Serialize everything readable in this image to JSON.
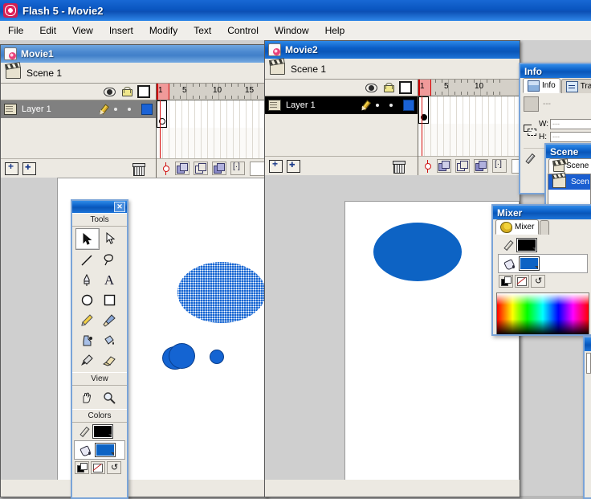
{
  "app": {
    "title": "Flash 5 - Movie2",
    "logo_icon": "flash-logo-icon"
  },
  "menubar": {
    "items": [
      {
        "label": "File"
      },
      {
        "label": "Edit"
      },
      {
        "label": "View"
      },
      {
        "label": "Insert"
      },
      {
        "label": "Modify"
      },
      {
        "label": "Text"
      },
      {
        "label": "Control"
      },
      {
        "label": "Window"
      },
      {
        "label": "Help"
      }
    ]
  },
  "movie1": {
    "title": "Movie1",
    "active": false,
    "scene_label": "Scene 1",
    "layer_headers": {
      "eye_icon": "eye-icon",
      "lock_icon": "lock-icon",
      "outline_icon": "outline-square-icon"
    },
    "layer": {
      "name": "Layer 1",
      "page_icon": "layer-page-icon",
      "pencil_icon": "pencil-icon",
      "swatch_color": "#1a62d6"
    },
    "ruler_labels": [
      "1",
      "5",
      "10",
      "15"
    ],
    "current_frame": "1",
    "bottom_icons": {
      "add_layer_icon": "add-layer-icon",
      "add_guide_icon": "add-motion-guide-icon",
      "delete_layer_icon": "trash-icon"
    },
    "onion_controls": {
      "center_frame_icon": "center-frame-icon",
      "onion_skin_icon": "onion-skin-icon",
      "onion_outline_icon": "onion-skin-outline-icon",
      "edit_multiple_icon": "edit-multiple-frames-icon",
      "modify_markers_icon": "modify-onion-markers-icon"
    }
  },
  "movie2": {
    "title": "Movie2",
    "active": true,
    "scene_label": "Scene 1",
    "layer": {
      "name": "Layer 1",
      "swatch_color": "#1a62d6"
    },
    "ruler_labels": [
      "1",
      "5",
      "10"
    ],
    "current_frame": "1"
  },
  "tools_panel": {
    "title_close_icon": "close-icon",
    "sections": [
      {
        "label": "Tools",
        "tools": [
          {
            "name": "arrow-tool",
            "glyph": "➤",
            "selected": true
          },
          {
            "name": "subselect-tool",
            "glyph": "➤",
            "selected": false
          },
          {
            "name": "line-tool",
            "glyph": "╱",
            "selected": false
          },
          {
            "name": "lasso-tool",
            "glyph": "⌀",
            "selected": false
          },
          {
            "name": "pen-tool",
            "glyph": "✒",
            "selected": false
          },
          {
            "name": "text-tool",
            "glyph": "A",
            "selected": false
          },
          {
            "name": "oval-tool",
            "glyph": "○",
            "selected": false
          },
          {
            "name": "rectangle-tool",
            "glyph": "□",
            "selected": false
          },
          {
            "name": "pencil-tool",
            "glyph": "✎",
            "selected": false
          },
          {
            "name": "brush-tool",
            "glyph": "὘C",
            "selected": false
          },
          {
            "name": "ink-bottle-tool",
            "glyph": "◆",
            "selected": false
          },
          {
            "name": "paint-bucket-tool",
            "glyph": "◇",
            "selected": false
          },
          {
            "name": "dropper-tool",
            "glyph": "✒",
            "selected": false
          },
          {
            "name": "eraser-tool",
            "glyph": "▱",
            "selected": false
          }
        ]
      },
      {
        "label": "View",
        "tools": [
          {
            "name": "hand-tool",
            "glyph": "✋",
            "selected": false
          },
          {
            "name": "zoom-tool",
            "glyph": "⌕",
            "selected": false
          }
        ]
      },
      {
        "label": "Colors",
        "stroke_color": "#000000",
        "fill_color": "#0d63c4",
        "stroke_icon": "pencil-stroke-icon",
        "fill_icon": "paint-bucket-fill-icon",
        "modifier_icons": [
          "default-colors-icon",
          "no-color-icon",
          "swap-colors-icon"
        ]
      }
    ]
  },
  "info_panel": {
    "title": "Info",
    "tabs": [
      {
        "label": "Info",
        "icon": "info-icon",
        "active": true
      },
      {
        "label": "Tran",
        "icon": "transform-icon",
        "active": false
      }
    ],
    "shape_value": "---",
    "fields": [
      {
        "label": "W:",
        "value": "---"
      },
      {
        "label": "H:",
        "value": "---"
      }
    ],
    "anchor_icon": "anchor-point-icon",
    "dropper_icon": "eyedropper-icon"
  },
  "scene_panel": {
    "title": "Scene",
    "tab_label": "Scene",
    "tab_icon": "scene-icon",
    "items": [
      {
        "label": "Scen",
        "icon": "clapperboard-icon",
        "selected": true
      }
    ]
  },
  "mixer_panel": {
    "title": "Mixer",
    "tabs": [
      {
        "label": "Mixer",
        "icon": "palette-icon",
        "active": true
      }
    ],
    "stroke_color": "#000000",
    "fill_color": "#0d63c4",
    "stroke_icon": "pencil-stroke-icon",
    "fill_icon": "paint-bucket-fill-icon",
    "modifier_icons": [
      "default-colors-icon",
      "no-color-icon",
      "swap-colors-icon"
    ],
    "gradient_name": "color-spectrum-strip"
  },
  "stage1": {
    "shapes": [
      {
        "name": "large-ellipse-selected",
        "fill": "#1464d2",
        "selected": true
      },
      {
        "name": "small-ellipse-a",
        "fill": "#1464d2",
        "selected": false
      },
      {
        "name": "small-ellipse-b",
        "fill": "#1464d2",
        "selected": false
      },
      {
        "name": "tiny-ellipse",
        "fill": "#1464d2",
        "selected": false
      }
    ]
  },
  "stage2": {
    "shapes": [
      {
        "name": "blue-ellipse",
        "fill": "#0d63c4",
        "selected": false
      }
    ]
  }
}
